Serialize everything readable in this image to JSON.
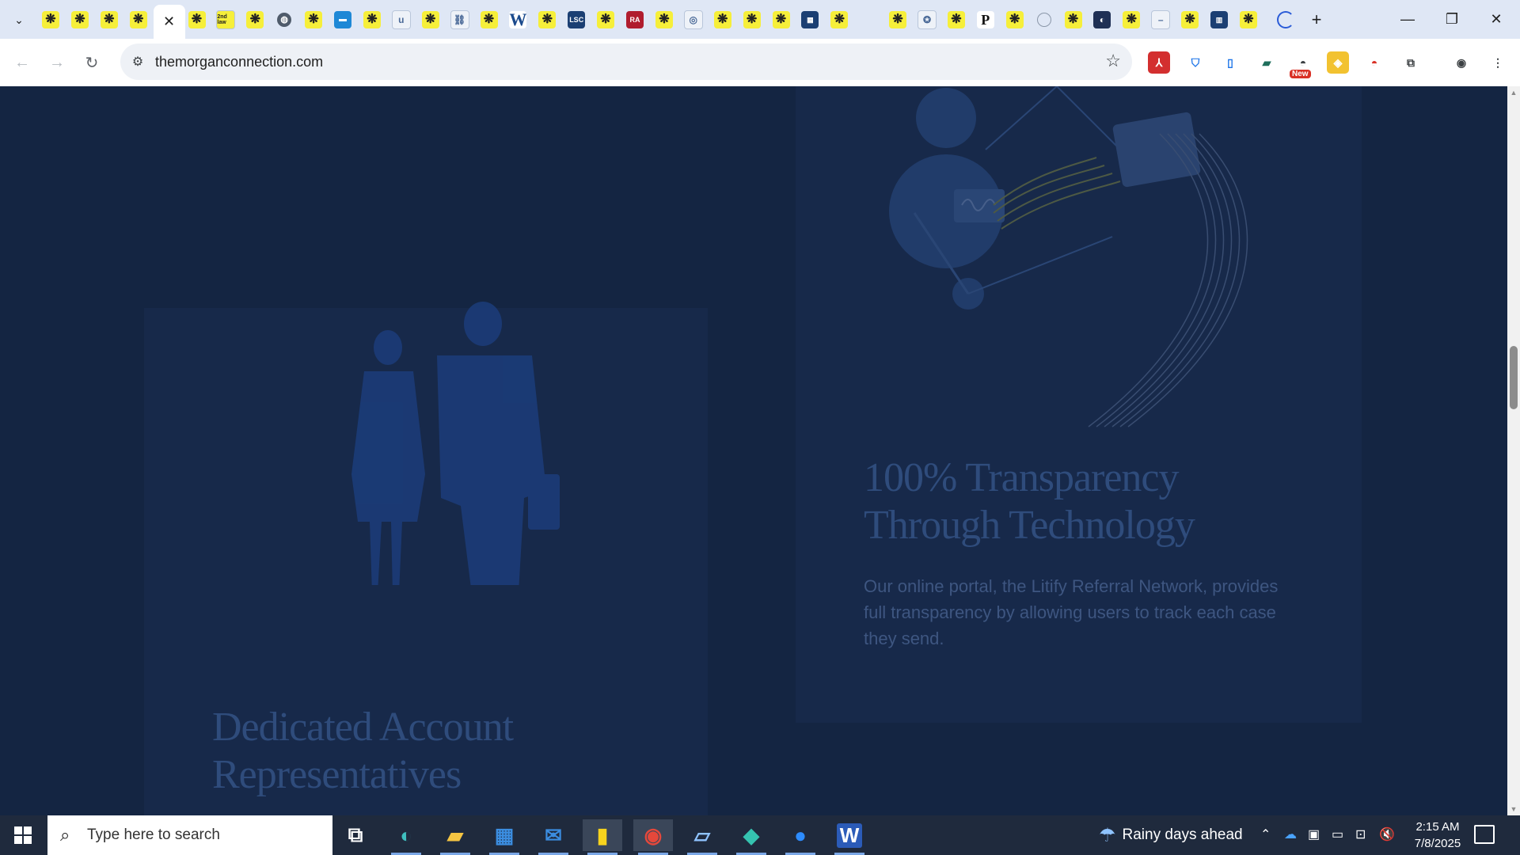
{
  "browser": {
    "tabs": [
      {
        "icon": "asterisk-icon",
        "glyph": "❋"
      },
      {
        "icon": "asterisk-icon",
        "glyph": "❋"
      },
      {
        "icon": "asterisk-icon",
        "glyph": "❋"
      },
      {
        "icon": "asterisk-icon",
        "glyph": "❋"
      },
      {
        "icon": "close-icon",
        "glyph": "✕",
        "active": true
      },
      {
        "icon": "asterisk-icon",
        "glyph": "❋"
      },
      {
        "icon": "2nd-law-icon",
        "glyph": "2nd law"
      },
      {
        "icon": "asterisk-icon",
        "glyph": "❋"
      },
      {
        "icon": "globe-icon",
        "glyph": "◍"
      },
      {
        "icon": "asterisk-icon",
        "glyph": "❋"
      },
      {
        "icon": "blue-square-icon",
        "glyph": "▬"
      },
      {
        "icon": "asterisk-icon",
        "glyph": "❋"
      },
      {
        "icon": "u-icon",
        "glyph": "u"
      },
      {
        "icon": "asterisk-icon",
        "glyph": "❋"
      },
      {
        "icon": "link-icon",
        "glyph": "⛓"
      },
      {
        "icon": "asterisk-icon",
        "glyph": "❋"
      },
      {
        "icon": "w-icon",
        "glyph": "W"
      },
      {
        "icon": "asterisk-icon",
        "glyph": "❋"
      },
      {
        "icon": "lsc-icon",
        "glyph": "LSC"
      },
      {
        "icon": "asterisk-icon",
        "glyph": "❋"
      },
      {
        "icon": "red-logo-icon",
        "glyph": "RA"
      },
      {
        "icon": "asterisk-icon",
        "glyph": "❋"
      },
      {
        "icon": "circle-logo-icon",
        "glyph": "◎"
      },
      {
        "icon": "asterisk-icon",
        "glyph": "❋"
      },
      {
        "icon": "asterisk-icon",
        "glyph": "❋"
      },
      {
        "icon": "asterisk-icon",
        "glyph": "❋"
      },
      {
        "icon": "grid-logo-icon",
        "glyph": "▦"
      },
      {
        "icon": "asterisk-icon",
        "glyph": "❋"
      },
      {
        "icon": "blank-icon",
        "glyph": ""
      },
      {
        "icon": "asterisk-icon",
        "glyph": "❋"
      },
      {
        "icon": "seal-icon",
        "glyph": "✪"
      },
      {
        "icon": "asterisk-icon",
        "glyph": "❋"
      },
      {
        "icon": "p-icon",
        "glyph": "P"
      },
      {
        "icon": "asterisk-icon",
        "glyph": "❋"
      },
      {
        "icon": "circle-icon",
        "glyph": ""
      },
      {
        "icon": "asterisk-icon",
        "glyph": "❋"
      },
      {
        "icon": "moon-icon",
        "glyph": "◐"
      },
      {
        "icon": "asterisk-icon",
        "glyph": "❋"
      },
      {
        "icon": "dash-icon",
        "glyph": "–"
      },
      {
        "icon": "asterisk-icon",
        "glyph": "❋"
      },
      {
        "icon": "building-icon",
        "glyph": "▥"
      },
      {
        "icon": "asterisk-icon",
        "glyph": "❋"
      }
    ],
    "url": "themorganconnection.com",
    "extensions": [
      {
        "icon": "pdf-icon",
        "glyph": "⅄",
        "bg": "#d32f2f"
      },
      {
        "icon": "shield-icon",
        "glyph": "⛉",
        "bg": "#ffffff"
      },
      {
        "icon": "book-icon",
        "glyph": "▯",
        "bg": "#ffffff"
      },
      {
        "icon": "wallet-icon",
        "glyph": "▰",
        "bg": "#ffffff"
      },
      {
        "icon": "new-extension-icon",
        "glyph": "◓",
        "bg": "#ffffff",
        "badge": "New"
      },
      {
        "icon": "diamond-icon",
        "glyph": "◈",
        "bg": "#f2c230"
      },
      {
        "icon": "pokeball-icon",
        "glyph": "◓",
        "bg": "#ffffff"
      },
      {
        "icon": "puzzle-icon",
        "glyph": "⧉",
        "bg": "#ffffff"
      },
      {
        "icon": "profile-icon",
        "glyph": "◉",
        "bg": "#ffffff"
      },
      {
        "icon": "kebab-menu-icon",
        "glyph": "⋮",
        "bg": "#ffffff"
      }
    ]
  },
  "page": {
    "transparency": {
      "heading_line1": "100% Transparency",
      "heading_line2": "Through Technology",
      "text": "Our online portal, the Litify Referral Network, provides full transparency by allowing users to track each case they send."
    },
    "representatives": {
      "heading_line1": "Dedicated Account",
      "heading_line2": "Representatives"
    }
  },
  "taskbar": {
    "search_placeholder": "Type here to search",
    "weather": "Rainy days ahead",
    "time": "2:15 AM",
    "date": "7/8/2025",
    "apps": [
      {
        "icon": "task-view-icon"
      },
      {
        "icon": "edge-icon"
      },
      {
        "icon": "file-explorer-icon"
      },
      {
        "icon": "store-icon"
      },
      {
        "icon": "mail-icon"
      },
      {
        "icon": "sticky-notes-icon"
      },
      {
        "icon": "chrome-icon"
      },
      {
        "icon": "notepad-icon"
      },
      {
        "icon": "kite-icon"
      },
      {
        "icon": "zoom-icon"
      },
      {
        "icon": "word-icon"
      }
    ]
  }
}
